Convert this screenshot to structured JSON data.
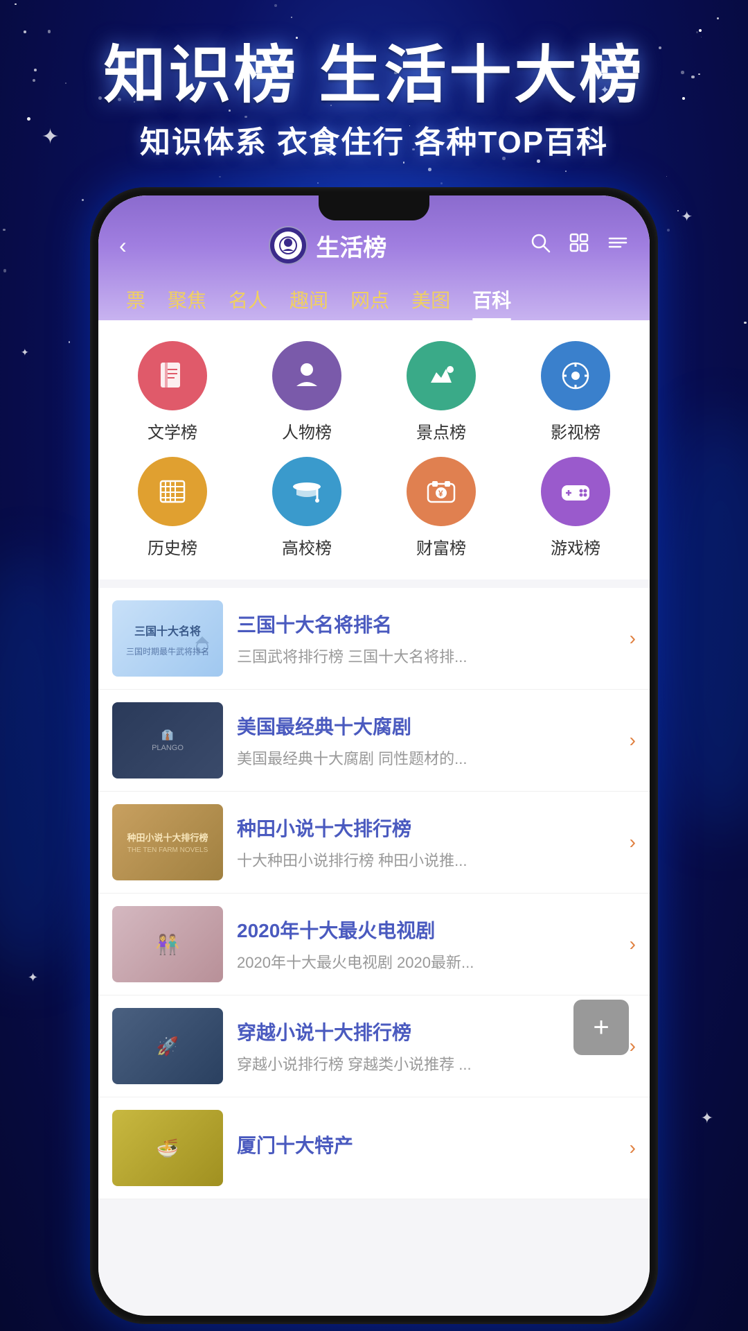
{
  "app": {
    "background": "#0a1060"
  },
  "hero": {
    "title": "知识榜 生活十大榜",
    "subtitle": "知识体系 衣食住行 各种TOP百科"
  },
  "header": {
    "title": "生活榜",
    "back_icon": "←",
    "search_icon": "🔍",
    "grid_icon": "⊞",
    "list_icon": "☰"
  },
  "nav_tabs": [
    {
      "label": "票",
      "active": false
    },
    {
      "label": "聚焦",
      "active": false
    },
    {
      "label": "名人",
      "active": false
    },
    {
      "label": "趣闻",
      "active": false
    },
    {
      "label": "网点",
      "active": false
    },
    {
      "label": "美图",
      "active": false
    },
    {
      "label": "百科",
      "active": true
    }
  ],
  "categories": [
    {
      "label": "文学榜",
      "icon": "📕",
      "color": "#e05a6a"
    },
    {
      "label": "人物榜",
      "icon": "👤",
      "color": "#7a5aaa"
    },
    {
      "label": "景点榜",
      "icon": "🏔",
      "color": "#3aaa88"
    },
    {
      "label": "影视榜",
      "icon": "🎬",
      "color": "#3a80cc"
    },
    {
      "label": "历史榜",
      "icon": "📋",
      "color": "#e0a030"
    },
    {
      "label": "高校榜",
      "icon": "🎓",
      "color": "#3a9acc"
    },
    {
      "label": "财富榜",
      "icon": "💴",
      "color": "#e08050"
    },
    {
      "label": "游戏榜",
      "icon": "🎮",
      "color": "#9a5acc"
    }
  ],
  "list_items": [
    {
      "title": "三国十大名将排名",
      "desc": "三国武将排行榜 三国十大名将排...",
      "thumb_text": "三国十大名将\n三国时期最牛武将排名",
      "thumb_style": "1"
    },
    {
      "title": "美国最经典十大腐剧",
      "desc": "美国最经典十大腐剧 同性题材的...",
      "thumb_text": "",
      "thumb_style": "2"
    },
    {
      "title": "种田小说十大排行榜",
      "desc": "十大种田小说排行榜 种田小说推...",
      "thumb_text": "种田小说十大排行榜\nTHE TEN FARM NOVELS",
      "thumb_style": "3"
    },
    {
      "title": "2020年十大最火电视剧",
      "desc": "2020年十大最火电视剧 2020最新...",
      "thumb_text": "",
      "thumb_style": "4"
    },
    {
      "title": "穿越小说十大排行榜",
      "desc": "穿越小说排行榜 穿越类小说推荐 ...",
      "thumb_text": "",
      "thumb_style": "5"
    },
    {
      "title": "厦门十大特产",
      "desc": "",
      "thumb_text": "",
      "thumb_style": "6"
    }
  ],
  "fab": {
    "label": "+"
  }
}
